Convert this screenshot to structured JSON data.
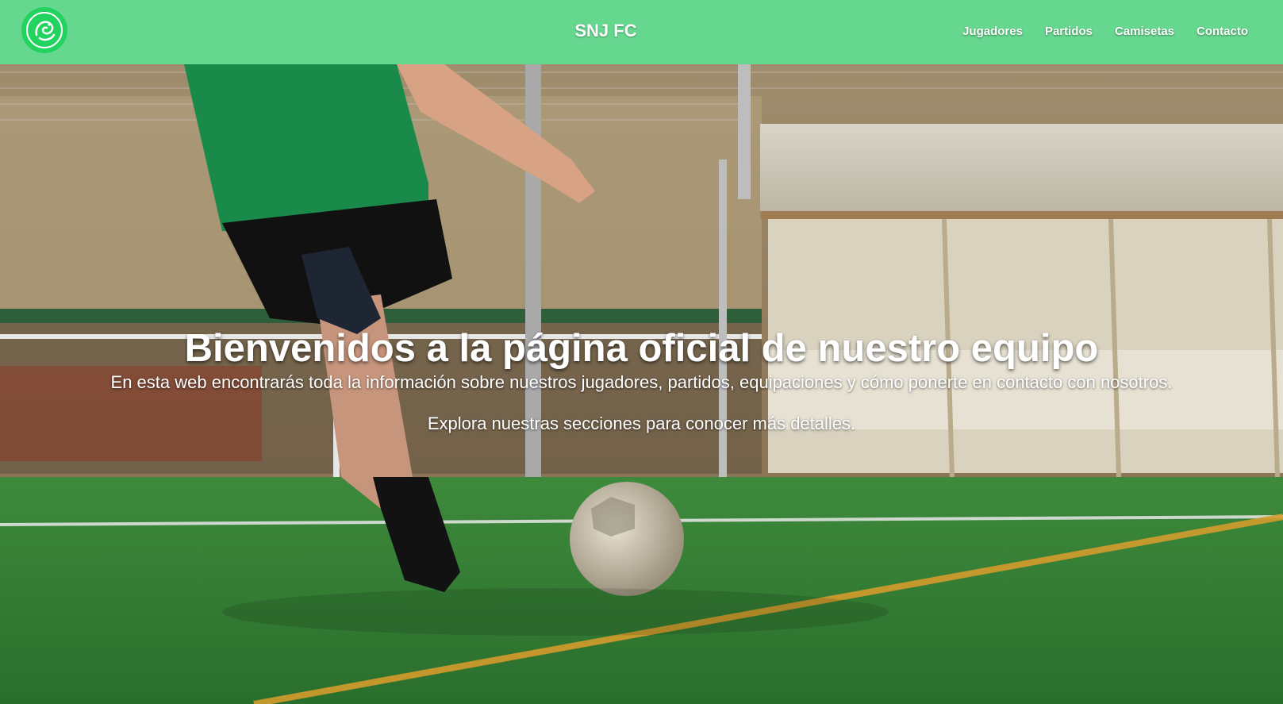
{
  "header": {
    "brand": "SNJ FC",
    "nav": [
      {
        "label": "Jugadores"
      },
      {
        "label": "Partidos"
      },
      {
        "label": "Camisetas"
      },
      {
        "label": "Contacto"
      }
    ],
    "logo_icon": "dragon-emblem-icon"
  },
  "hero": {
    "title": "Bienvenidos a la página oficial de nuestro equipo",
    "intro": "En esta web encontrarás toda la información sobre nuestros jugadores, partidos, equipaciones y cómo ponerte en contacto con nosotros.",
    "explore": "Explora nuestras secciones para conocer más detalles."
  },
  "colors": {
    "header_bg": "#66d78f",
    "logo_bg": "#1fd35d",
    "text": "#ffffff"
  }
}
